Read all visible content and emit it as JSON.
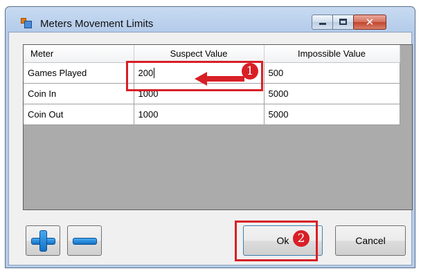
{
  "window": {
    "title": "Meters Movement Limits",
    "controls": {
      "minimize_icon": "minimize-icon",
      "maximize_icon": "maximize-icon",
      "close_glyph": "✕"
    }
  },
  "grid": {
    "columns": [
      "Meter",
      "Suspect Value",
      "Impossible Value"
    ],
    "rows": [
      {
        "meter": "Games Played",
        "suspect": "200",
        "impossible": "500"
      },
      {
        "meter": "Coin In",
        "suspect": "1000",
        "impossible": "5000"
      },
      {
        "meter": "Coin Out",
        "suspect": "1000",
        "impossible": "5000"
      }
    ]
  },
  "buttons": {
    "add_icon": "plus-icon",
    "remove_icon": "minus-icon",
    "ok_label": "Ok",
    "cancel_label": "Cancel"
  },
  "annotations": {
    "step1": "1",
    "step2": "2",
    "color": "#d81f26"
  }
}
